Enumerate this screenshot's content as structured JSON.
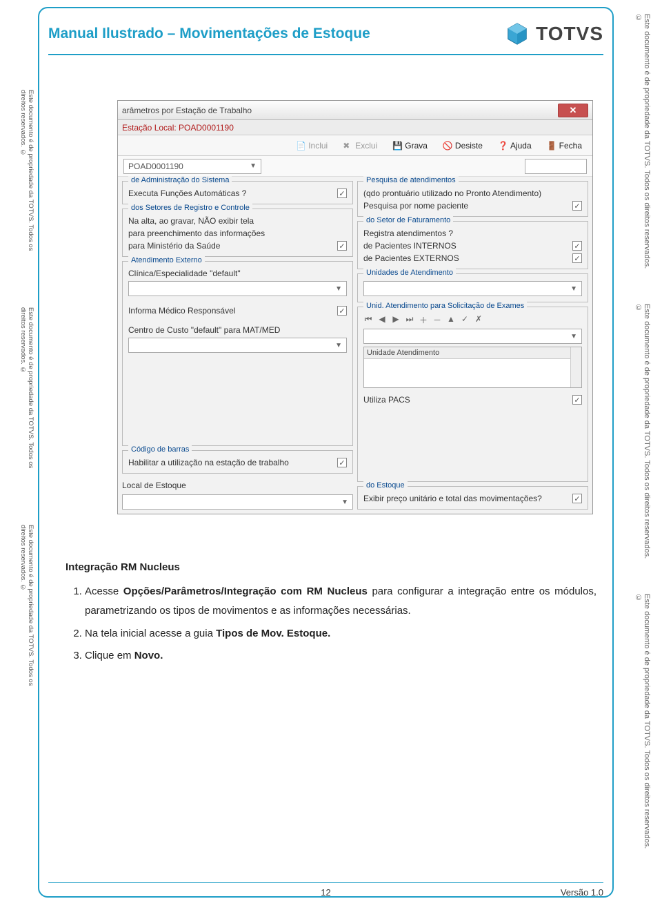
{
  "doc": {
    "title": "Manual Ilustrado – Movimentações de Estoque",
    "brand": "TOTVS"
  },
  "side_text_left": "Este documento é de propriedade da TOTVS. Todos os direitos reservados. ©",
  "side_text_right": "Este documento é de propriedade da TOTVS. Todos os direitos reservados. ©",
  "window": {
    "title": "arâmetros por Estação de Trabalho",
    "subtitle": "Estação Local: POAD0001190",
    "toolbar": {
      "inclui": "Inclui",
      "exclui": "Exclui",
      "grava": "Grava",
      "desiste": "Desiste",
      "ajuda": "Ajuda",
      "fecha": "Fecha"
    },
    "station_value": "POAD0001190",
    "left": {
      "g1_title": "de Administração do Sistema",
      "g1_l1": "Executa Funções Automáticas ?",
      "g2_title": "dos Setores de Registro e Controle",
      "g2_l1": "Na alta, ao gravar, NÃO exibir tela",
      "g2_l2": "para preenchimento das informações",
      "g2_l3": "para Ministério da Saúde",
      "g3_title": "Atendimento Externo",
      "g3_l1": "Clínica/Especialidade \"default\"",
      "g3_l2": "Informa Médico Responsável",
      "g3_l3": "Centro de Custo \"default\"  para MAT/MED",
      "g4_title": "Código de barras",
      "g4_l1": "Habilitar a utilização na estação de trabalho",
      "local_estoque": "Local de Estoque"
    },
    "right": {
      "g1_title": "Pesquisa de atendimentos",
      "g1_l1": "(qdo prontuário  utilizado no Pronto Atendimento)",
      "g1_l2": "Pesquisa por nome paciente",
      "g2_title": "do Setor de Faturamento",
      "g2_l0": "Registra atendimentos ?",
      "g2_l1": "de Pacientes INTERNOS",
      "g2_l2": "de Pacientes EXTERNOS",
      "g3_title": "Unidades de Atendimento",
      "g4_title": "Unid. Atendimento para Solicitação de Exames",
      "list_header": "Unidade Atendimento",
      "pacs": "Utiliza PACS",
      "g5_title": "do Estoque",
      "g5_l1": "Exibir preço unitário e total das movimentações?"
    }
  },
  "text": {
    "heading": "Integração RM Nucleus",
    "item1_pre": "Acesse ",
    "item1_bold": "Opções/Parâmetros/Integração com RM Nucleus",
    "item1_post": " para configurar a integração entre os módulos, parametrizando os tipos de movimentos e as informações necessárias.",
    "item2_pre": "Na tela inicial acesse a guia ",
    "item2_bold": "Tipos de Mov. Estoque.",
    "item3_pre": "Clique em ",
    "item3_bold": "Novo."
  },
  "footer": {
    "page": "12",
    "version": "Versão 1.0"
  }
}
